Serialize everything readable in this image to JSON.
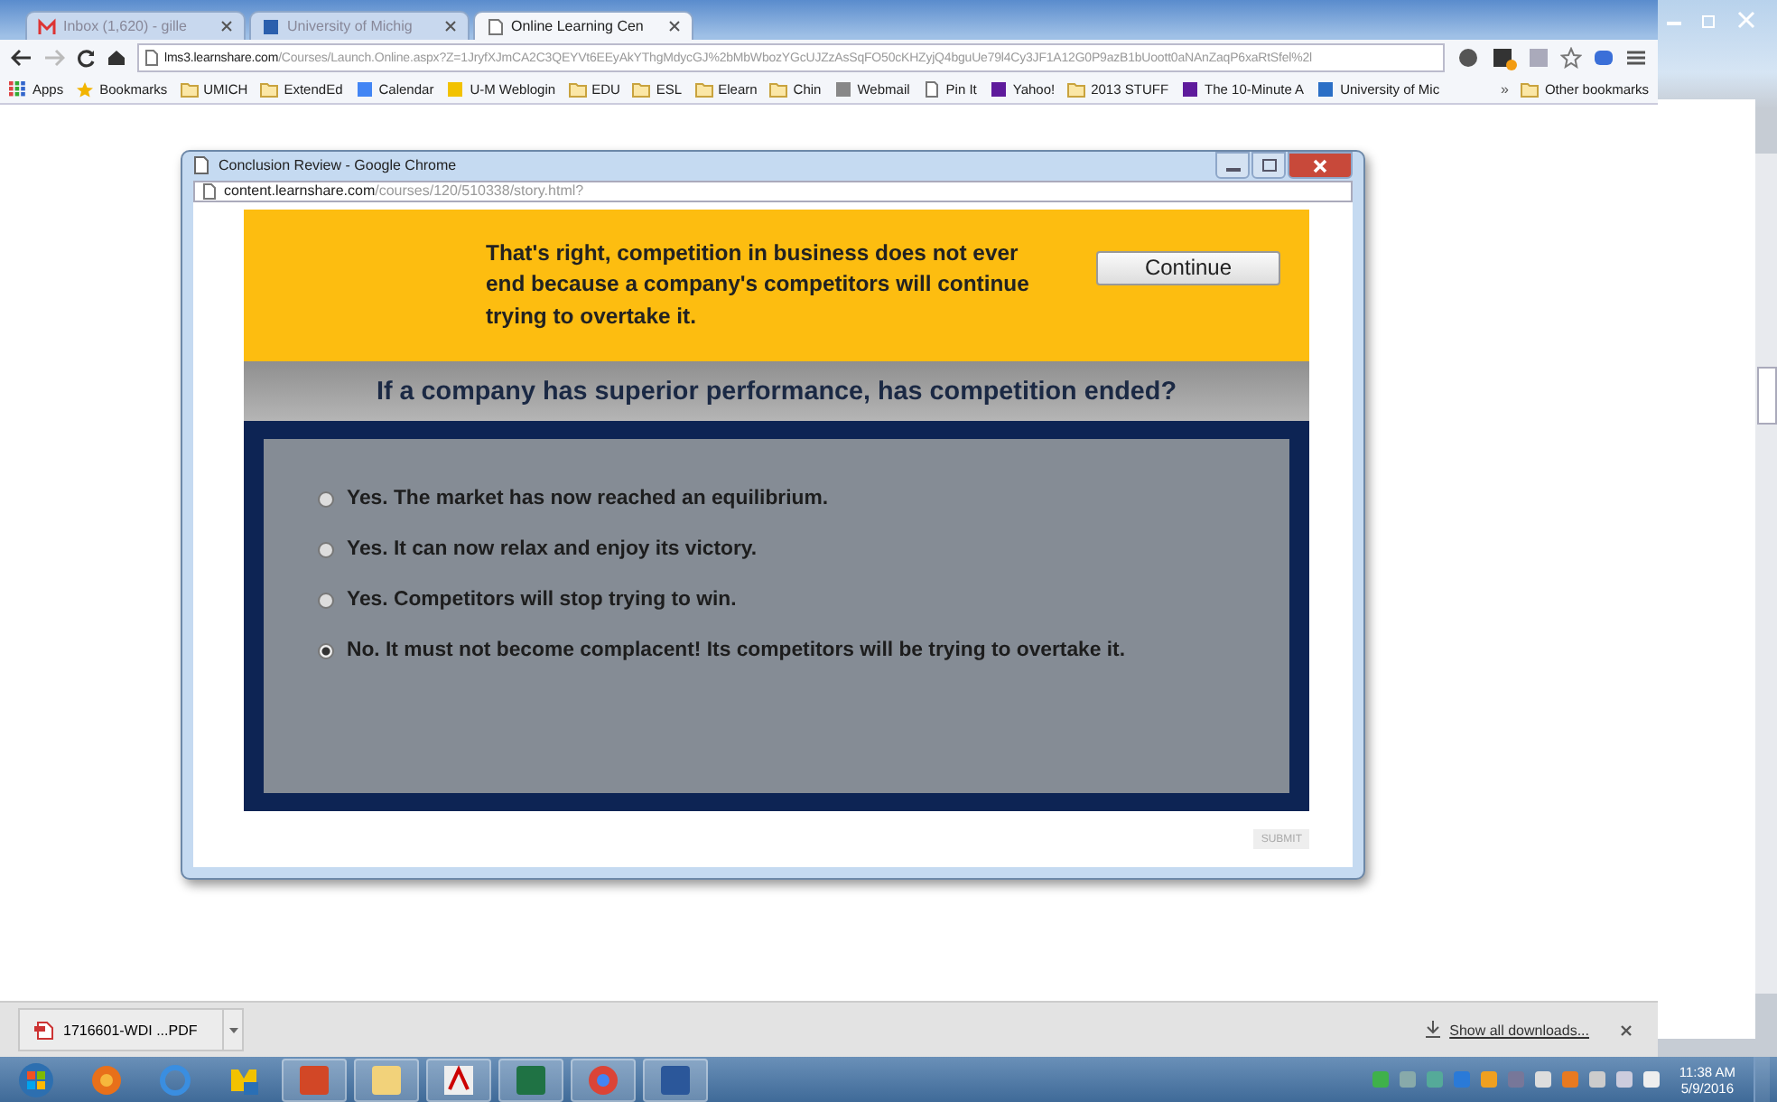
{
  "browser": {
    "tabs": [
      {
        "label": "Inbox (1,620) - gille",
        "kind": "mail",
        "selected": false
      },
      {
        "label": "University of Michig",
        "kind": "site",
        "selected": false
      },
      {
        "label": "Online Learning Cen",
        "kind": "page",
        "selected": true
      }
    ],
    "address": {
      "host": "lms3.learnshare.com",
      "path": "/Courses/Launch.Online.aspx?Z=1JryfXJmCA2C3QEYVt6EEyAkYThgMdycGJ%2bMbWbozYGcUJZzAsSqFO50cKHZyjQ4bguUe79l4Cy3JF1A12G0P9azB1bUoott0aNAnZaqP6xaRtSfel%2l"
    },
    "bookmarks": [
      {
        "label": "Apps",
        "kind": "apps"
      },
      {
        "label": "Bookmarks",
        "kind": "star"
      },
      {
        "label": "UMICH",
        "kind": "folder"
      },
      {
        "label": "ExtendEd",
        "kind": "folder"
      },
      {
        "label": "Calendar",
        "kind": "google"
      },
      {
        "label": "U-M Weblogin",
        "kind": "block"
      },
      {
        "label": "EDU",
        "kind": "folder"
      },
      {
        "label": "ESL",
        "kind": "folder"
      },
      {
        "label": "Elearn",
        "kind": "folder"
      },
      {
        "label": "Chin",
        "kind": "folder"
      },
      {
        "label": "Webmail",
        "kind": "webmail"
      },
      {
        "label": "Pin It",
        "kind": "page"
      },
      {
        "label": "Yahoo!",
        "kind": "yahoo"
      },
      {
        "label": "2013 STUFF",
        "kind": "folder"
      },
      {
        "label": "The 10-Minute A",
        "kind": "yahoo"
      },
      {
        "label": "University of Mic",
        "kind": "save"
      }
    ],
    "more_bookmarks": "»",
    "other_bookmarks": "Other bookmarks"
  },
  "popup": {
    "title": "Conclusion Review - Google Chrome",
    "host": "content.learnshare.com",
    "path": "/courses/120/510338/story.html?",
    "feedback": "That's right, competition in business does not ever end because a company's competitors will continue trying to overtake it.",
    "continue": "Continue",
    "question": "If a company has superior performance, has competition ended?",
    "options": [
      {
        "label": "Yes. The market has now reached an equilibrium.",
        "selected": false
      },
      {
        "label": "Yes. It can now relax and enjoy its victory.",
        "selected": false
      },
      {
        "label": "Yes. Competitors will stop trying to win.",
        "selected": false
      },
      {
        "label": "No. It must not become complacent! Its competitors will be trying to overtake it.",
        "selected": true
      }
    ],
    "submit": "SUBMIT"
  },
  "downloads": {
    "file": "1716601-WDI ...PDF",
    "show_all": "Show all downloads..."
  },
  "taskbar": {
    "time": "11:38 AM",
    "date": "5/9/2016"
  }
}
